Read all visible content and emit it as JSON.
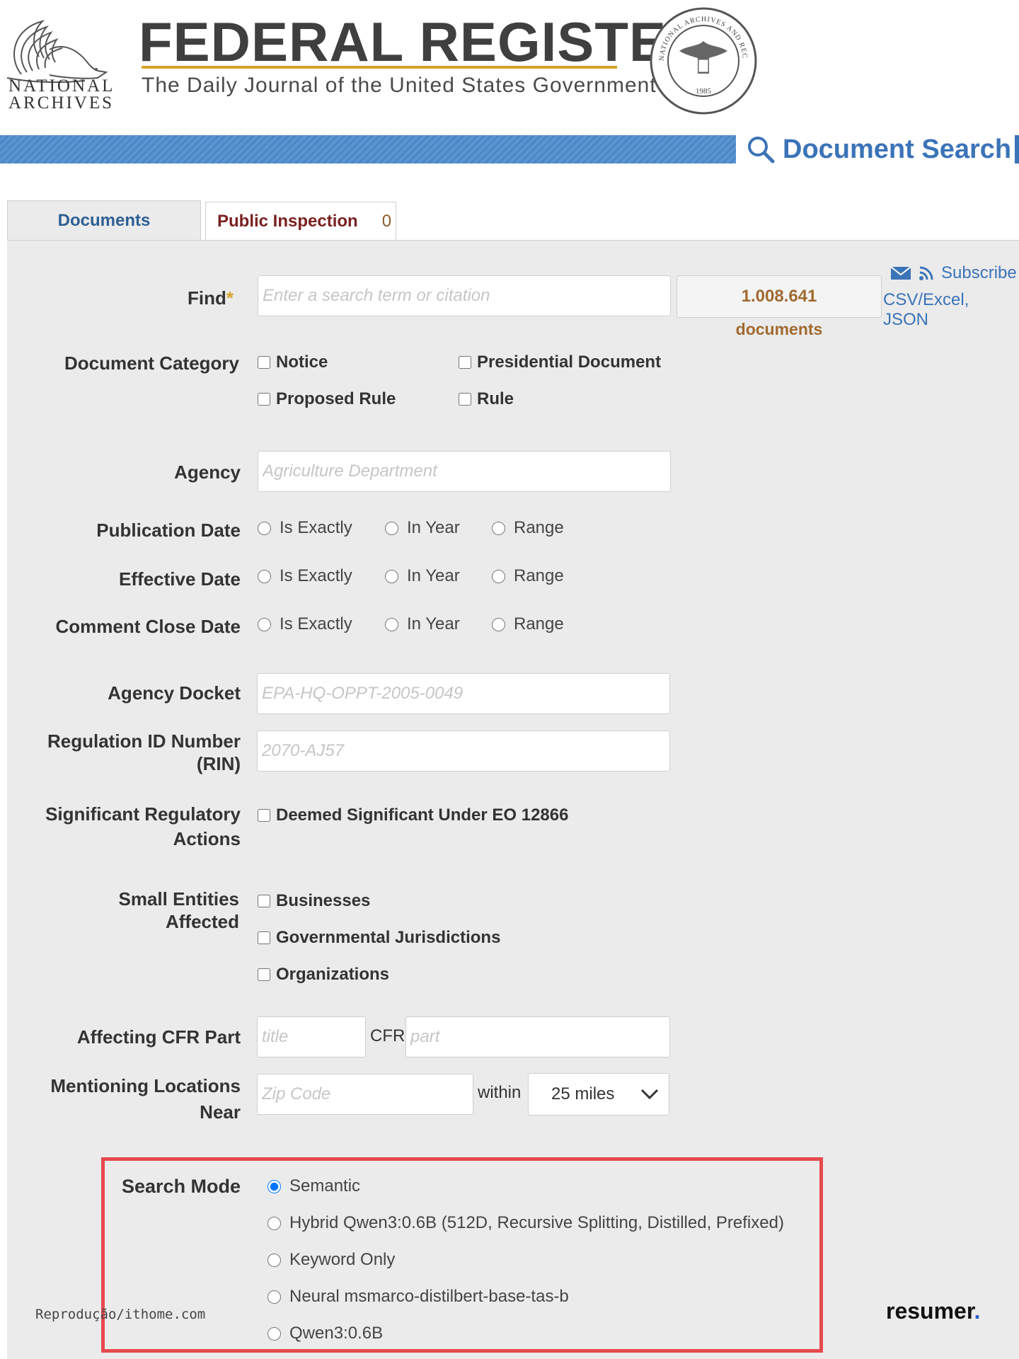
{
  "header": {
    "archives_text": [
      "NATIONAL",
      "ARCHIVES"
    ],
    "title": "FEDERAL REGISTER",
    "subtitle": "The Daily Journal of the United States Government",
    "seal_text": "NATIONAL ARCHIVES AND RECORDS ADMINISTRATION",
    "seal_year": "1985",
    "search_link": "Document Search"
  },
  "tabs": {
    "documents": "Documents",
    "public_inspection": "Public Inspection",
    "public_inspection_count": "0"
  },
  "form": {
    "find_label": "Find",
    "find_required_marker": "*",
    "find_placeholder": "Enter a search term or citation",
    "result_count": "1.008.641",
    "result_count_label": "documents",
    "subscribe": "Subscribe",
    "export": "CSV/Excel, JSON",
    "doc_category_label": "Document Category",
    "doc_categories": [
      "Notice",
      "Presidential Document",
      "Proposed Rule",
      "Rule"
    ],
    "agency_label": "Agency",
    "agency_placeholder": "Agriculture Department",
    "date_options": [
      "Is Exactly",
      "In Year",
      "Range"
    ],
    "publication_date_label": "Publication Date",
    "effective_date_label": "Effective Date",
    "comment_close_date_label": "Comment Close Date",
    "agency_docket_label": "Agency Docket",
    "agency_docket_placeholder": "EPA-HQ-OPPT-2005-0049",
    "rin_label_1": "Regulation ID Number",
    "rin_label_2": "(RIN)",
    "rin_placeholder": "2070-AJ57",
    "significant_label_1": "Significant Regulatory",
    "significant_label_2": "Actions",
    "significant_option": "Deemed Significant Under EO 12866",
    "small_entities_label_1": "Small Entities",
    "small_entities_label_2": "Affected",
    "small_entities_options": [
      "Businesses",
      "Governmental Jurisdictions",
      "Organizations"
    ],
    "cfr_label": "Affecting CFR Part",
    "cfr_title_placeholder": "title",
    "cfr_text": "CFR",
    "cfr_part_placeholder": "part",
    "locations_label_1": "Mentioning Locations",
    "locations_label_2": "Near",
    "zip_placeholder": "Zip Code",
    "within_text": "within",
    "miles_value": "25 miles"
  },
  "search_mode": {
    "label": "Search Mode",
    "options": [
      "Semantic",
      "Hybrid Qwen3:0.6B (512D, Recursive Splitting, Distilled, Prefixed)",
      "Keyword Only",
      "Neural msmarco-distilbert-base-tas-b",
      "Qwen3:0.6B"
    ],
    "selected": "Semantic",
    "highlight_color": "#e8494d"
  },
  "overlay": {
    "watermark": "Reprodução/ithome.com",
    "brand": "resumer",
    "brand_dot": "."
  },
  "colors": {
    "link_blue": "#3b73b8",
    "gold": "#d8a32b",
    "panel_gray": "#ebebeb"
  }
}
